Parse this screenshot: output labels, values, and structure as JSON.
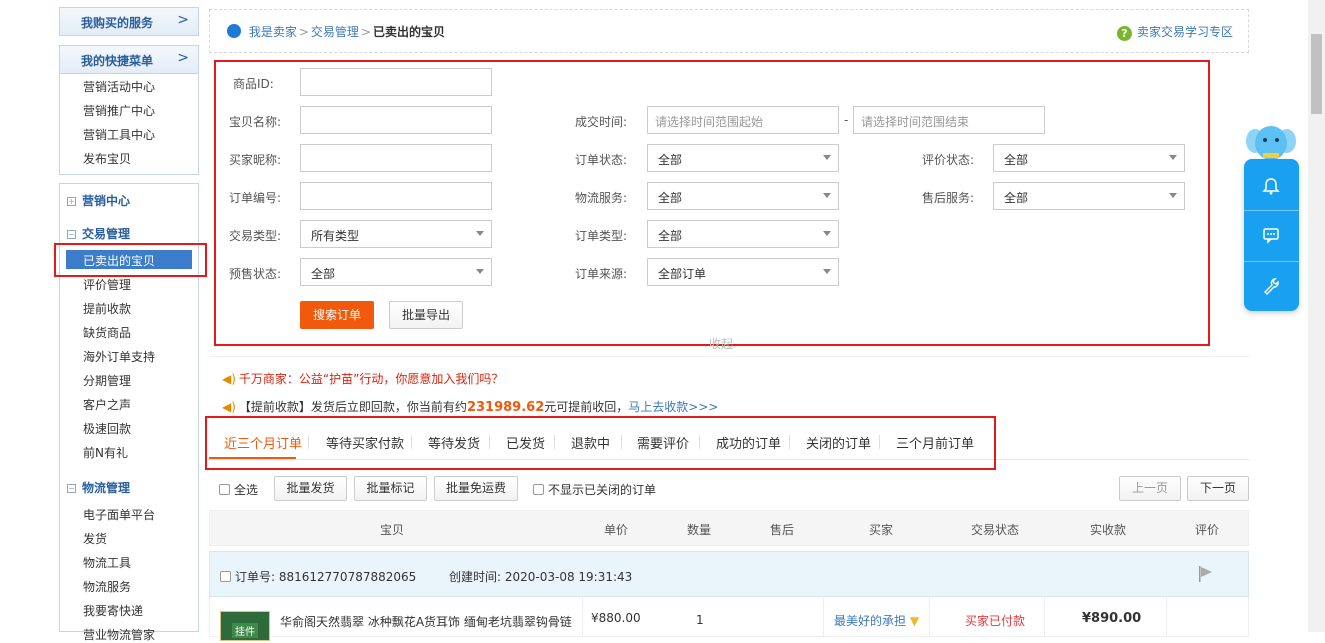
{
  "sidebar": {
    "bought": "我购买的服务",
    "quick_menu": "我的快捷菜单",
    "quick_items": [
      "营销活动中心",
      "营销推广中心",
      "营销工具中心",
      "发布宝贝"
    ],
    "marketing": "营销中心",
    "trade": "交易管理",
    "trade_items": [
      "已卖出的宝贝",
      "评价管理",
      "提前收款",
      "缺货商品",
      "海外订单支持",
      "分期管理",
      "客户之声",
      "极速回款",
      "前N有礼"
    ],
    "logistics": "物流管理",
    "logistics_items": [
      "电子面单平台",
      "发货",
      "物流工具",
      "物流服务",
      "我要寄快递",
      "营业物流管家"
    ]
  },
  "header": {
    "crumb1": "我是卖家",
    "crumb2": "交易管理",
    "crumb3": "已卖出的宝贝",
    "help": "卖家交易学习专区"
  },
  "form": {
    "product_id": "商品ID:",
    "item_name": "宝贝名称:",
    "deal_time": "成交时间:",
    "time_start_ph": "请选择时间范围起始",
    "time_dash": "-",
    "time_end_ph": "请选择时间范围结束",
    "buyer_nick": "买家昵称:",
    "order_status": "订单状态:",
    "order_status_val": "全部",
    "review_status": "评价状态:",
    "review_status_val": "全部",
    "order_no": "订单编号:",
    "logistics_service": "物流服务:",
    "logistics_service_val": "全部",
    "after_sale": "售后服务:",
    "after_sale_val": "全部",
    "trade_type": "交易类型:",
    "trade_type_val": "所有类型",
    "order_type": "订单类型:",
    "order_type_val": "全部",
    "presale": "预售状态:",
    "presale_val": "全部",
    "order_source": "订单来源:",
    "order_source_val": "全部订单",
    "search_btn": "搜索订单",
    "export_btn": "批量导出",
    "collapse": "收起"
  },
  "notices": {
    "n1": "千万商家：公益“护苗”行动，你愿意加入我们吗？",
    "n2_pre": "【提前收款】发货后立即回款，你当前有约",
    "n2_amount": "231989.62",
    "n2_mid": "元可提前收回，",
    "n2_link": "马上去收款>>>"
  },
  "tabs": [
    "近三个月订单",
    "等待买家付款",
    "等待发货",
    "已发货",
    "退款中",
    "需要评价",
    "成功的订单",
    "关闭的订单",
    "三个月前订单"
  ],
  "toolbar": {
    "select_all": "全选",
    "batch_ship": "批量发货",
    "batch_mark": "批量标记",
    "batch_free": "批量免运费",
    "hide_closed": "不显示已关闭的订单",
    "prev": "上一页",
    "next": "下一页"
  },
  "table": {
    "headers": [
      "宝贝",
      "单价",
      "数量",
      "售后",
      "买家",
      "交易状态",
      "实收款",
      "评价"
    ],
    "order_no_label": "订单号: 881612770787882065",
    "created_label": "创建时间: 2020-03-08 19:31:43",
    "item_title": "华俞阁天然翡翠 冰种飘花A货耳饰 缅甸老坑翡翠钩骨链",
    "thumb_text": "挂件",
    "price": "¥880.00",
    "qty": "1",
    "buyer": "最美好的承担",
    "status": "买家已付款",
    "paid": "¥890.00"
  }
}
